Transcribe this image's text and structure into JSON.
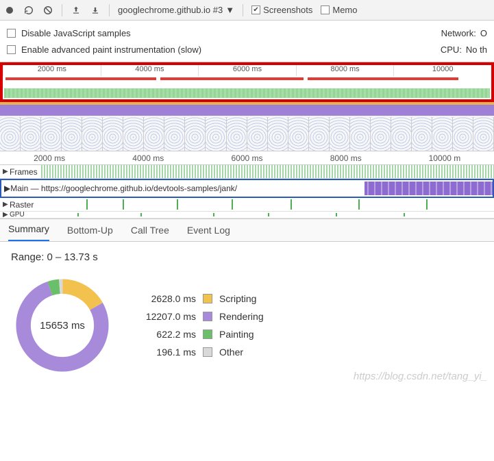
{
  "toolbar": {
    "dropdown": "googlechrome.github.io #3",
    "screenshots_label": "Screenshots",
    "screenshots_checked": true,
    "memory_label": "Memo"
  },
  "settings": {
    "disable_js": "Disable JavaScript samples",
    "enable_paint": "Enable advanced paint instrumentation (slow)",
    "network_label": "Network:",
    "network_value": "O",
    "cpu_label": "CPU:",
    "cpu_value": "No th"
  },
  "overview_ticks": [
    "2000 ms",
    "4000 ms",
    "6000 ms",
    "8000 ms",
    "10000"
  ],
  "timeline_ticks": [
    "2000 ms",
    "4000 ms",
    "6000 ms",
    "8000 ms",
    "10000 m"
  ],
  "tracks": {
    "frames": "Frames",
    "main": "Main — https://googlechrome.github.io/devtools-samples/jank/",
    "raster": "Raster",
    "gpu": "GPU"
  },
  "tabs": {
    "summary": "Summary",
    "bottom_up": "Bottom-Up",
    "call_tree": "Call Tree",
    "event_log": "Event Log"
  },
  "summary": {
    "range": "Range: 0 – 13.73 s",
    "total": "15653 ms",
    "items": [
      {
        "ms": "2628.0 ms",
        "label": "Scripting",
        "color": "#f2c14e"
      },
      {
        "ms": "12207.0 ms",
        "label": "Rendering",
        "color": "#a78bda"
      },
      {
        "ms": "622.2 ms",
        "label": "Painting",
        "color": "#6bbf6b"
      },
      {
        "ms": "196.1 ms",
        "label": "Other",
        "color": "#d9d9d9"
      }
    ]
  },
  "chart_data": {
    "type": "pie",
    "title": "Range: 0 – 13.73 s",
    "series": [
      {
        "name": "Scripting",
        "value": 2628.0,
        "color": "#f2c14e"
      },
      {
        "name": "Rendering",
        "value": 12207.0,
        "color": "#a78bda"
      },
      {
        "name": "Painting",
        "value": 622.2,
        "color": "#6bbf6b"
      },
      {
        "name": "Other",
        "value": 196.1,
        "color": "#d9d9d9"
      }
    ],
    "total_label": "15653 ms"
  },
  "watermark": "https://blog.csdn.net/tang_yi_"
}
